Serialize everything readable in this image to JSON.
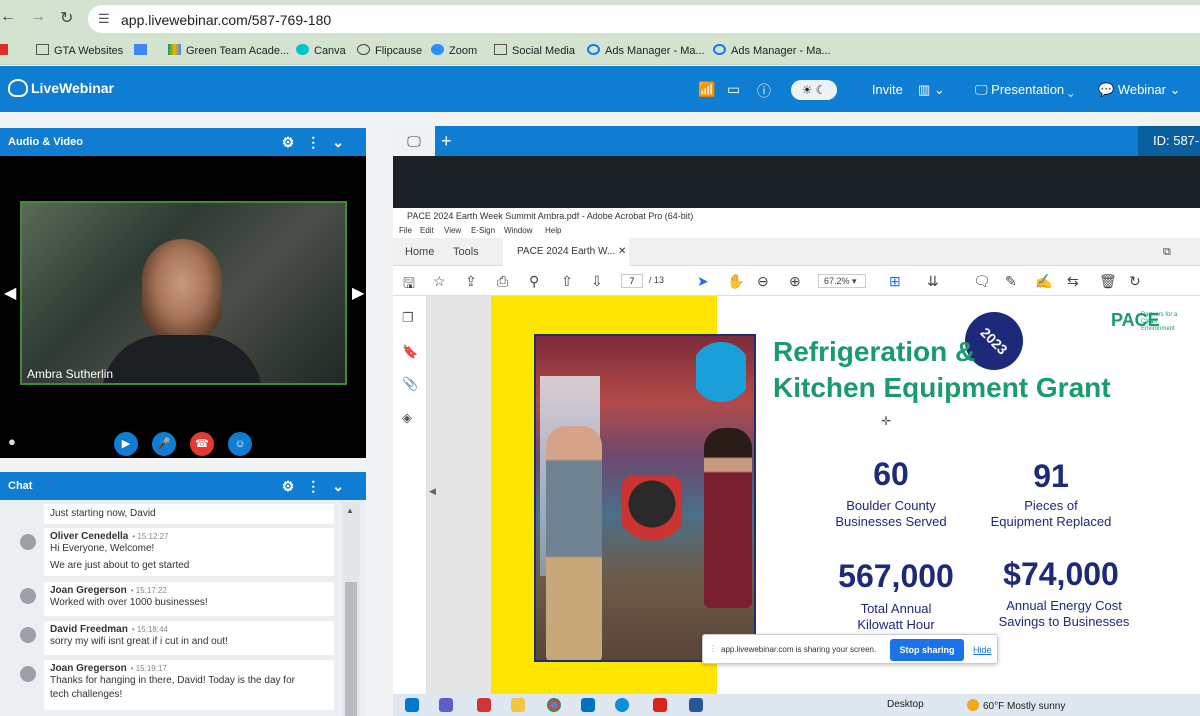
{
  "browser": {
    "url": "app.livewebinar.com/587-769-180",
    "bookmarks": [
      "GTA Websites",
      "Green Team Acade...",
      "Canva",
      "Flipcause",
      "Zoom",
      "Social Media",
      "Ads Manager - Ma...",
      "Ads Manager - Ma..."
    ]
  },
  "header": {
    "logo": "LiveWebinar",
    "invite": "Invite",
    "presentation": "Presentation",
    "webinar": "Webinar"
  },
  "av_panel": {
    "title": "Audio & Video",
    "speaker_name": "Ambra Sutherlin"
  },
  "chat": {
    "title": "Chat",
    "messages": [
      {
        "author": "",
        "time": "",
        "lines": [
          "Just starting now, David"
        ]
      },
      {
        "author": "Oliver Cenedella",
        "time": "15:12:27",
        "lines": [
          "Hi Everyone, Welcome!",
          "We are just about to get started"
        ]
      },
      {
        "author": "Joan Gregerson",
        "time": "15:17:22",
        "lines": [
          "Worked with over 1000 businesses!"
        ]
      },
      {
        "author": "David Freedman",
        "time": "15:18:44",
        "lines": [
          "sorry my wifi isnt great if i cut in and out!"
        ]
      },
      {
        "author": "Joan Gregerson",
        "time": "15:19:17",
        "lines": [
          "Thanks for hanging in there, David! Today is the day for",
          "tech challenges!"
        ]
      }
    ]
  },
  "presentation": {
    "room_id": "ID: 587-"
  },
  "acrobat": {
    "window_title": "PACE 2024 Earth Week Summit Ambra.pdf - Adobe Acrobat Pro (64-bit)",
    "menu": [
      "File",
      "Edit",
      "View",
      "E-Sign",
      "Window",
      "Help"
    ],
    "tabs": {
      "home": "Home",
      "tools": "Tools",
      "document": "PACE 2024 Earth W..."
    },
    "page_current": "7",
    "page_total": "/ 13",
    "zoom": "67.2%"
  },
  "slide": {
    "title_line1": "Refrigeration &",
    "title_line2": "Kitchen Equipment Grant",
    "year": "2023",
    "logo": "PACE",
    "logo_sub": "Partners for a Clean Environment",
    "stats": [
      {
        "value": "60",
        "label_line1": "Boulder County",
        "label_line2": "Businesses Served"
      },
      {
        "value": "91",
        "label_line1": "Pieces of",
        "label_line2": "Equipment Replaced"
      },
      {
        "value": "567,000",
        "label_line1": "Total Annual",
        "label_line2": "Kilowatt Hour"
      },
      {
        "value": "$74,000",
        "label_line1": "Annual Energy Cost",
        "label_line2": "Savings to Businesses"
      }
    ]
  },
  "share_banner": {
    "text": "app.livewebinar.com is sharing your screen.",
    "stop": "Stop sharing",
    "hide": "Hide"
  },
  "taskbar": {
    "desktop": "Desktop",
    "weather": "60°F  Mostly sunny"
  },
  "colors": {
    "brand_blue": "#0f7dd1",
    "slide_green": "#1a9b6c",
    "slide_navy": "#1d2a7a",
    "slide_yellow": "#ffe600"
  }
}
